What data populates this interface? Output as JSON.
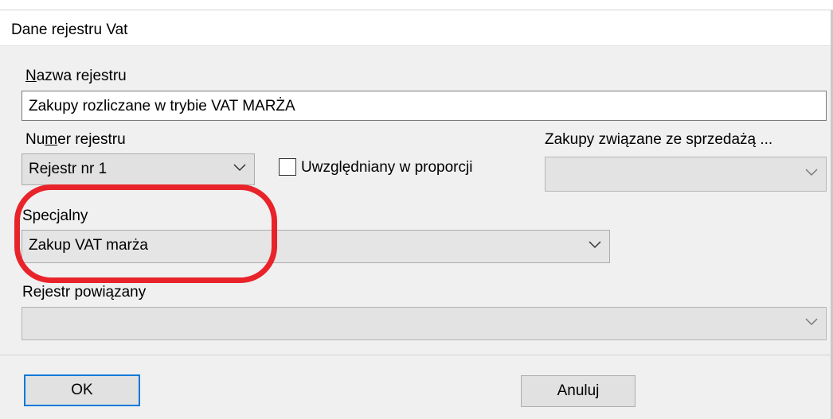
{
  "dialog": {
    "title": "Dane rejestru Vat"
  },
  "name_field": {
    "label_first": "N",
    "label_rest": "azwa rejestru",
    "value": "Zakupy rozliczane w trybie VAT MARŻA"
  },
  "number_field": {
    "label_pre": "Nu",
    "label_ul": "m",
    "label_post": "er rejestru",
    "value": "Rejestr nr 1"
  },
  "proportion_checkbox": {
    "label": "Uwzględniany w proporcji",
    "checked": false
  },
  "sales_related": {
    "label": "Zakupy związane ze sprzedażą ...",
    "value": ""
  },
  "special": {
    "label": "Specjalny",
    "value": "Zakup VAT marża"
  },
  "linked_register": {
    "label": "Rejestr powiązany",
    "value": ""
  },
  "buttons": {
    "ok": "OK",
    "cancel": "Anuluj"
  },
  "colors": {
    "annotation": "#e8232a",
    "focus": "#0078d7"
  }
}
